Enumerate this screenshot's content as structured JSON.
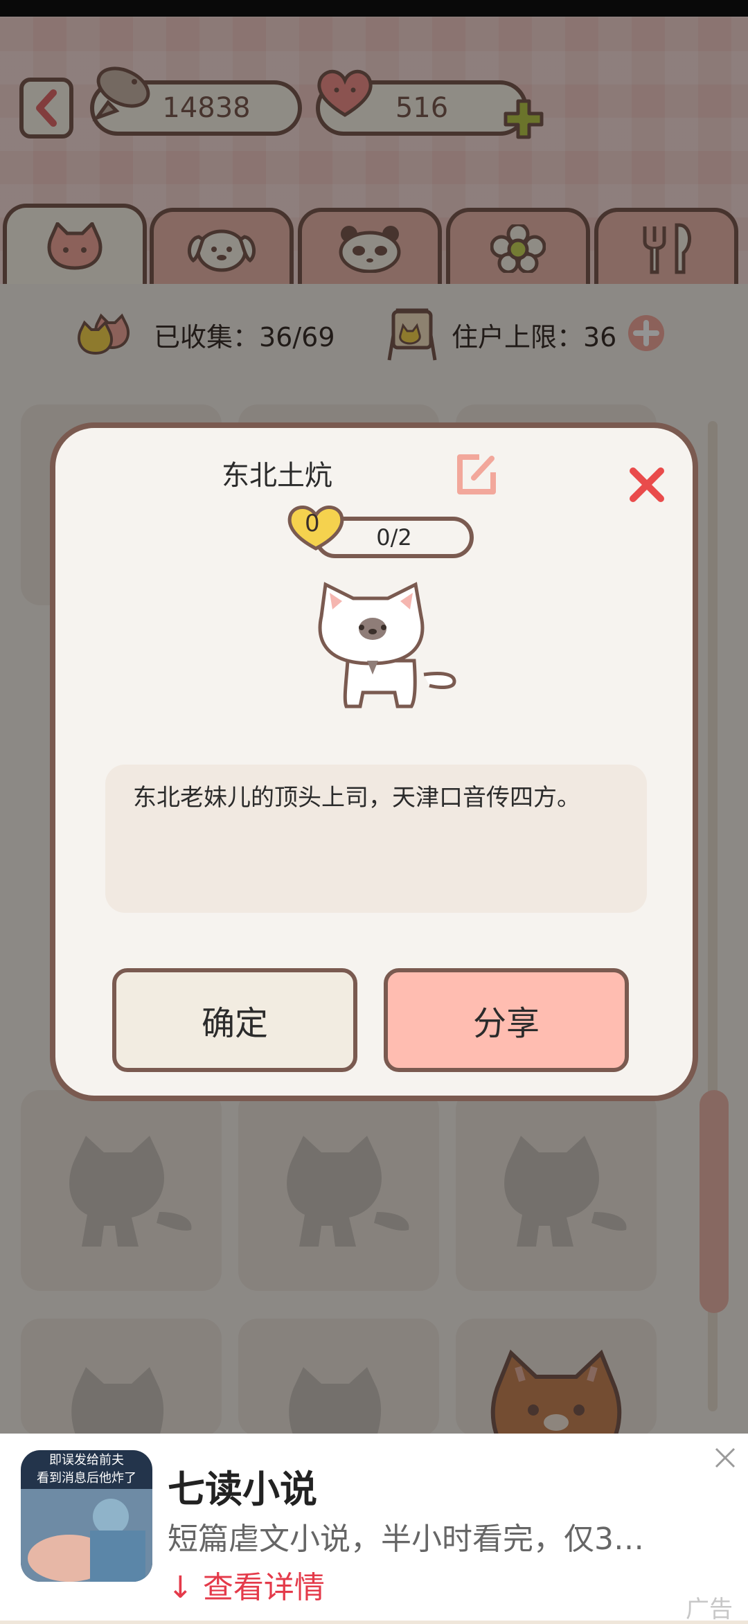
{
  "header": {
    "fish_count": "14838",
    "heart_count": "516"
  },
  "tabs": [
    {
      "name": "cat",
      "icon": "cat-face-icon",
      "active": true
    },
    {
      "name": "dog",
      "icon": "dog-face-icon"
    },
    {
      "name": "panda",
      "icon": "panda-face-icon"
    },
    {
      "name": "flower",
      "icon": "flower-icon"
    },
    {
      "name": "food",
      "icon": "fork-spoon-icon"
    }
  ],
  "stats": {
    "collected_label": "已收集：36/69",
    "residents_label": "住户上限：36"
  },
  "dialog": {
    "title": "东北土炕",
    "heart_badge": "0",
    "progress": "0/2",
    "description": "东北老妹儿的顶头上司，天津口音传四方。",
    "confirm_label": "确定",
    "share_label": "分享"
  },
  "ad": {
    "thumb_line_1": "即误发给前夫",
    "thumb_line_2": "看到消息后他炸了",
    "title": "七读小说",
    "subtitle": "短篇虐文小说，半小时看完，仅3…",
    "link": "↓ 查看详情",
    "tag": "广告"
  },
  "colors": {
    "border": "#7a5a50",
    "tab_bg": "#e9b5aa",
    "accent_pink": "#ffbdb1",
    "close_red": "#e94b4b",
    "link_red": "#e43a4a"
  }
}
